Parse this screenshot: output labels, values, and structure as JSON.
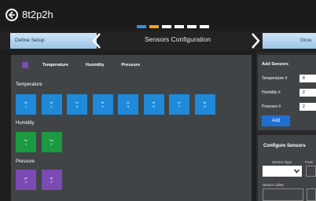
{
  "app": {
    "title": "8t2p2h"
  },
  "steps": {
    "count": 6,
    "active": 2,
    "active_color": "#3b8fe0",
    "done_color": "#f0a020",
    "idle_color": "#ffffff"
  },
  "nav": {
    "prev_label": "Define Setup",
    "title": "Sensors Configuration",
    "next_label": "Grou"
  },
  "filters": {
    "items": [
      "Temperature",
      "Humidity",
      "Pressure"
    ]
  },
  "groups": {
    "temperature": {
      "label": "Temperature",
      "tiles": [
        {
          "top": "te",
          "num": "1"
        },
        {
          "top": "te",
          "num": "2"
        },
        {
          "top": "te",
          "num": "3"
        },
        {
          "top": "te",
          "num": "4"
        },
        {
          "top": "te",
          "num": "5"
        },
        {
          "top": "te",
          "num": "6"
        },
        {
          "top": "te",
          "num": "7"
        },
        {
          "top": "te",
          "num": "8"
        }
      ]
    },
    "humidity": {
      "label": "Humidity",
      "tiles": [
        {
          "top": "hu",
          "num": "1"
        },
        {
          "top": "hu",
          "num": "2"
        }
      ]
    },
    "pressure": {
      "label": "Pressure",
      "tiles": [
        {
          "top": "pr",
          "num": "1"
        },
        {
          "top": "pr",
          "num": "2"
        }
      ]
    }
  },
  "add_sensors": {
    "title": "Add Sensors",
    "rows": [
      {
        "label": "Temperature #",
        "value": "8"
      },
      {
        "label": "Humidity #",
        "value": "2"
      },
      {
        "label": "Pressure #",
        "value": "2"
      }
    ],
    "add_label": "Add"
  },
  "configure": {
    "title": "Configure Sensors",
    "type_label": "Sensor Type",
    "from_label": "From",
    "sensor_label": "Sensor Label"
  }
}
